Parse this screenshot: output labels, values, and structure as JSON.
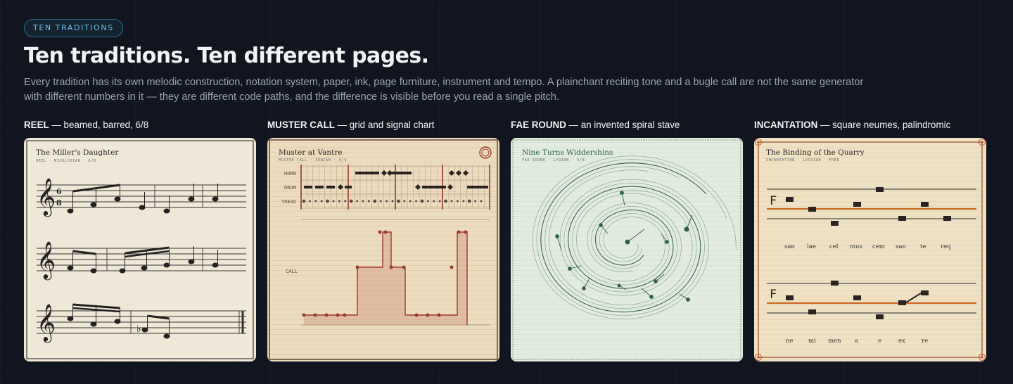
{
  "badge": "TEN TRADITIONS",
  "heading": "Ten traditions. Ten different pages.",
  "description": "Every tradition has its own melodic construction, notation system, paper, ink, page furniture, instrument and tempo. A plainchant reciting tone and a bugle call are not the same generator with different numbers in it — they are different code paths, and the difference is visible before you read a single pitch.",
  "cards": [
    {
      "heading": "REEL",
      "subheading": " — beamed, barred, 6/8",
      "piece_title": "The Miller's Daughter",
      "meta": "REEL · MIXOLYDIAN · 6/8",
      "time_sig_top": "6",
      "time_sig_bottom": "8"
    },
    {
      "heading": "MUSTER CALL",
      "subheading": " — grid and signal chart",
      "piece_title": "Muster at Vantre",
      "meta": "MUSTER CALL · IONIAN · 4/4",
      "rows": [
        "HORN",
        "DRUM",
        "TREAD"
      ],
      "chart_label": "CALL"
    },
    {
      "heading": "FAE ROUND",
      "subheading": " — an invented spiral stave",
      "piece_title": "Nine Turns Widdershins",
      "meta": "FAE ROUND · LYDIAN · 5/8"
    },
    {
      "heading": "INCANTATION",
      "subheading": " — square neumes, palindromic",
      "piece_title": "The Binding of the Quarry",
      "meta": "INCANTATION · LOCRIAN · FREE",
      "syllables_1": [
        "san",
        "lae",
        "cel",
        "mus",
        "cem",
        "san",
        "te",
        "req"
      ],
      "syllables_2": [
        "ne",
        "mi",
        "men",
        "a",
        "e",
        "ex",
        "re"
      ]
    }
  ],
  "colors": {
    "badge_accent": "#6cc0e6",
    "page_bg": "#10151f",
    "muster_ink": "#9a3b2c",
    "fae_ink": "#2f5f4c",
    "incantation_line": "#d06a2a"
  }
}
